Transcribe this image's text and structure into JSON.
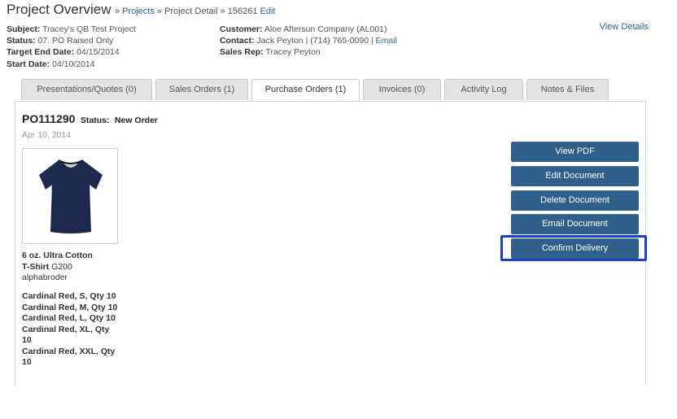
{
  "header": {
    "title": "Project Overview",
    "sep1": " » ",
    "projects_link": "Projects",
    "sep2": " » ",
    "project_detail": "Project Detail",
    "sep3": " » ",
    "project_id": "156261",
    "edit_link": "Edit"
  },
  "meta_left": {
    "subject_label": "Subject:",
    "subject_value": "Tracey's QB Test Project",
    "status_label": "Status:",
    "status_value": "07. PO Raised Only",
    "target_label": "Target End Date:",
    "target_value": "04/15/2014",
    "start_label": "Start Date:",
    "start_value": "04/10/2014"
  },
  "meta_right": {
    "customer_label": "Customer:",
    "customer_value": "Aloe Aftersun Company (AL001)",
    "contact_label": "Contact:",
    "contact_value": "Jack Peyton | (714) 765-0090 | ",
    "contact_email": "Email",
    "rep_label": "Sales Rep:",
    "rep_value": "Tracey Peyton"
  },
  "view_details": "View Details",
  "tabs": [
    {
      "label": "Presentations/Quotes (0)"
    },
    {
      "label": "Sales Orders (1)"
    },
    {
      "label": "Purchase Orders (1)"
    },
    {
      "label": "Invoices (0)"
    },
    {
      "label": "Activity Log"
    },
    {
      "label": "Notes & Files"
    }
  ],
  "active_tab": "Purchase Orders (1)",
  "po": {
    "number": "PO111290",
    "status_label": "Status:",
    "status_value": "New Order",
    "date": "Apr 10, 2014",
    "product_line1": "6 oz. Ultra Cotton",
    "product_line2_bold": "T-Shirt",
    "product_line2_rest": " G200",
    "supplier": "alphabroder",
    "variants": [
      "Cardinal Red, S, Qty 10",
      "Cardinal Red, M, Qty 10",
      "Cardinal Red, L, Qty 10",
      "Cardinal Red, XL, Qty 10",
      "Cardinal Red, XXL, Qty 10"
    ]
  },
  "actions": {
    "view_pdf": "View PDF",
    "edit_document": "Edit Document",
    "delete_document": "Delete Document",
    "email_document": "Email Document",
    "confirm_delivery": "Confirm Delivery"
  },
  "colors": {
    "button": "#2f5f8b",
    "link": "#2a6496",
    "highlight": "#1a3fd6",
    "shirt": "#1b2a4e"
  },
  "icons": {
    "product_image": "navy-t-shirt"
  }
}
